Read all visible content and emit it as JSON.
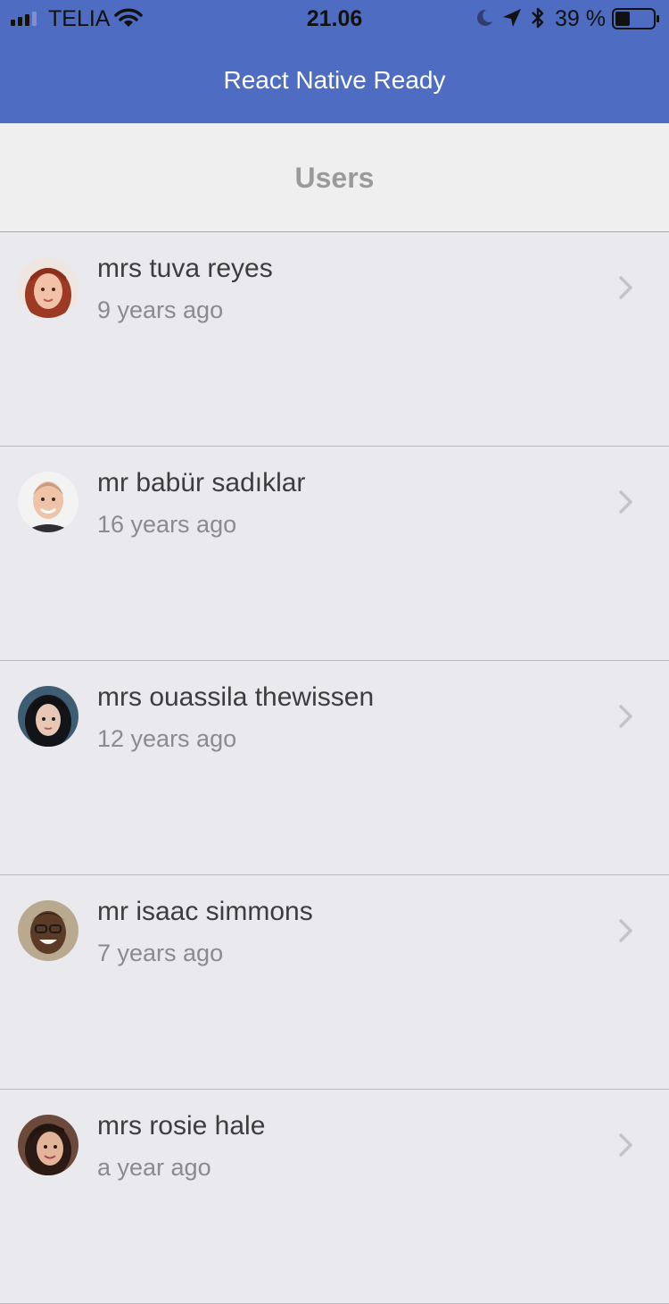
{
  "status_bar": {
    "carrier": "TELIA",
    "time": "21.06",
    "battery_percent": "39 %",
    "battery_level": 0.39
  },
  "nav": {
    "title": "React Native Ready",
    "color": "#4f6cc3"
  },
  "section": {
    "title": "Users"
  },
  "users": [
    {
      "name": "mrs tuva reyes",
      "subtitle": "9 years ago",
      "avatar": "woman-redhead-avatar"
    },
    {
      "name": "mr babür sadıklar",
      "subtitle": "16 years ago",
      "avatar": "man-bald-avatar"
    },
    {
      "name": "mrs ouassila thewissen",
      "subtitle": "12 years ago",
      "avatar": "woman-dark-hair-avatar"
    },
    {
      "name": "mr isaac simmons",
      "subtitle": "7 years ago",
      "avatar": "man-glasses-avatar"
    },
    {
      "name": "mrs rosie hale",
      "subtitle": "a year ago",
      "avatar": "woman-brown-hair-avatar"
    }
  ],
  "icons": {
    "signal": "signal-bars-icon",
    "wifi": "wifi-icon",
    "moon": "moon-icon",
    "location": "location-arrow-icon",
    "bluetooth": "bluetooth-icon",
    "battery": "battery-icon",
    "chevron": "chevron-right-icon"
  }
}
